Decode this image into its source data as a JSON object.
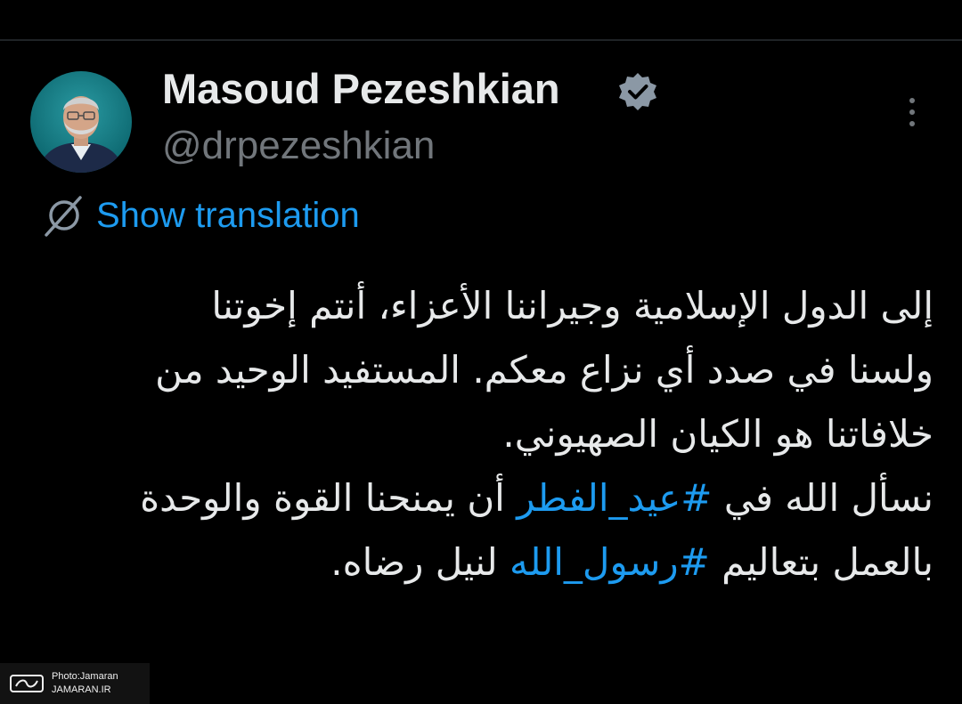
{
  "author": {
    "display_name": "Masoud Pezeshkian",
    "handle": "@drpezeshkian",
    "verified": true
  },
  "translate": {
    "label": "Show translation"
  },
  "tweet": {
    "line1": "إلى الدول الإسلامية وجيراننا الأعزاء، أنتم إخوتنا",
    "line2": "ولسنا في صدد أي نزاع معكم. المستفيد الوحيد من",
    "line3": "خلافاتنا هو الكيان الصهيوني.",
    "line4_before": "نسأل الله في ",
    "hashtag1": "#عيد_الفطر",
    "line4_after": " أن يمنحنا القوة والوحدة",
    "line5_before": "بالعمل بتعاليم ",
    "hashtag2": "#رسول_الله",
    "line5_after": " لنيل رضاه."
  },
  "watermark": {
    "credit": "Photo:Jamaran",
    "site": "JAMARAN.IR"
  },
  "icons": {
    "verified": "verified-badge-icon",
    "more": "more-options-icon",
    "translate": "translate-globe-icon"
  },
  "colors": {
    "background": "#000000",
    "accent_link": "#1d9bf0",
    "secondary_text": "#71767b",
    "primary_text": "#e7e9ea"
  }
}
